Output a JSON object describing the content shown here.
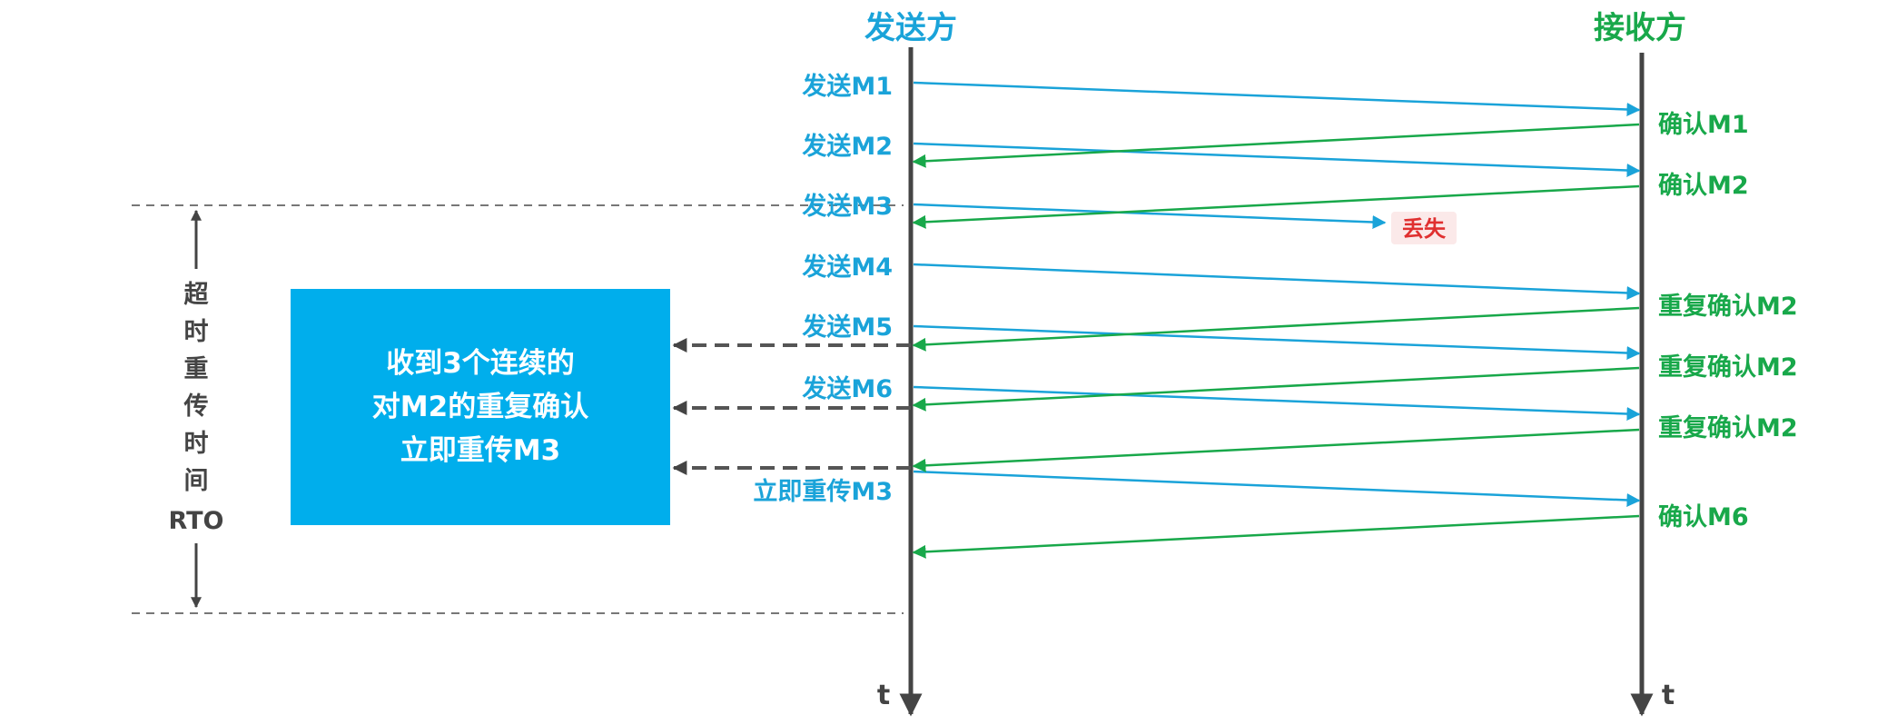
{
  "headers": {
    "sender": "发送方",
    "receiver": "接收方"
  },
  "time_label": "t",
  "send_labels": [
    "发送M1",
    "发送M2",
    "发送M3",
    "发送M4",
    "发送M5",
    "发送M6",
    "立即重传M3"
  ],
  "ack_labels": [
    "确认M1",
    "确认M2",
    "重复确认M2",
    "重复确认M2",
    "重复确认M2",
    "确认M6"
  ],
  "lost_label": "丢失",
  "rto_label": [
    "超",
    "时",
    "重",
    "传",
    "时",
    "间",
    "RTO"
  ],
  "box_lines": [
    "收到3个连续的",
    "对M2的重复确认",
    "立即重传M3"
  ],
  "colors": {
    "send": "#1aa3d9",
    "ack": "#18a84a",
    "lost": "#e03030",
    "box": "#00aeec",
    "axis": "#444444"
  }
}
